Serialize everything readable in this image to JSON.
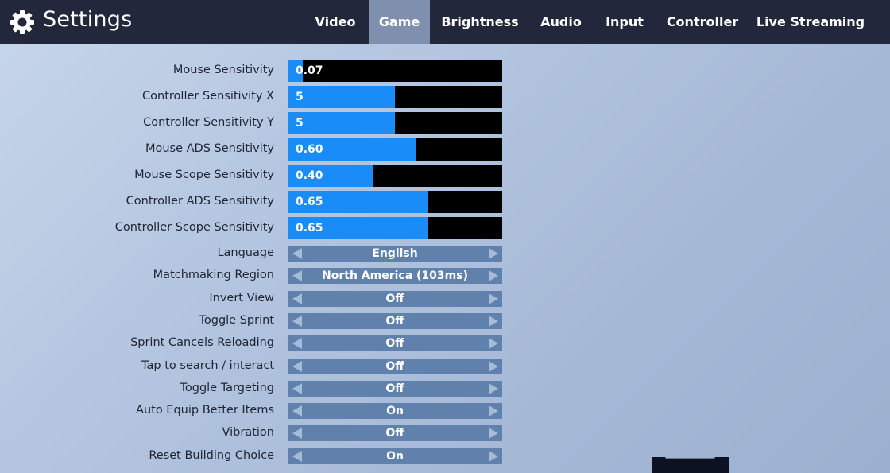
{
  "header": {
    "title": "Settings",
    "icon": "gear-icon",
    "tabs": [
      {
        "label": "Video",
        "active": false
      },
      {
        "label": "Game",
        "active": true
      },
      {
        "label": "Brightness",
        "active": false
      },
      {
        "label": "Audio",
        "active": false
      },
      {
        "label": "Input",
        "active": false
      },
      {
        "label": "Controller",
        "active": false
      },
      {
        "label": "Live Streaming",
        "active": false
      }
    ]
  },
  "colors": {
    "accent": "#1a8cf7",
    "header_bg": "#22273b",
    "active_tab": "#7f8fae",
    "selector_bg": "#5f81ab"
  },
  "sliders": [
    {
      "label": "Mouse Sensitivity",
      "value": "0.07",
      "fill_fraction": 0.07
    },
    {
      "label": "Controller Sensitivity X",
      "value": "5",
      "fill_fraction": 0.5
    },
    {
      "label": "Controller Sensitivity Y",
      "value": "5",
      "fill_fraction": 0.5
    },
    {
      "label": "Mouse ADS Sensitivity",
      "value": "0.60",
      "fill_fraction": 0.6
    },
    {
      "label": "Mouse Scope Sensitivity",
      "value": "0.40",
      "fill_fraction": 0.4
    },
    {
      "label": "Controller ADS Sensitivity",
      "value": "0.65",
      "fill_fraction": 0.65
    },
    {
      "label": "Controller Scope Sensitivity",
      "value": "0.65",
      "fill_fraction": 0.65
    }
  ],
  "selectors": [
    {
      "label": "Language",
      "value": "English"
    },
    {
      "label": "Matchmaking Region",
      "value": "North America (103ms)"
    },
    {
      "label": "Invert View",
      "value": "Off"
    },
    {
      "label": "Toggle Sprint",
      "value": "Off"
    },
    {
      "label": "Sprint Cancels Reloading",
      "value": "Off"
    },
    {
      "label": "Tap to search / interact",
      "value": "Off"
    },
    {
      "label": "Toggle Targeting",
      "value": "Off"
    },
    {
      "label": "Auto Equip Better Items",
      "value": "On"
    },
    {
      "label": "Vibration",
      "value": "Off"
    },
    {
      "label": "Reset Building Choice",
      "value": "On"
    }
  ]
}
